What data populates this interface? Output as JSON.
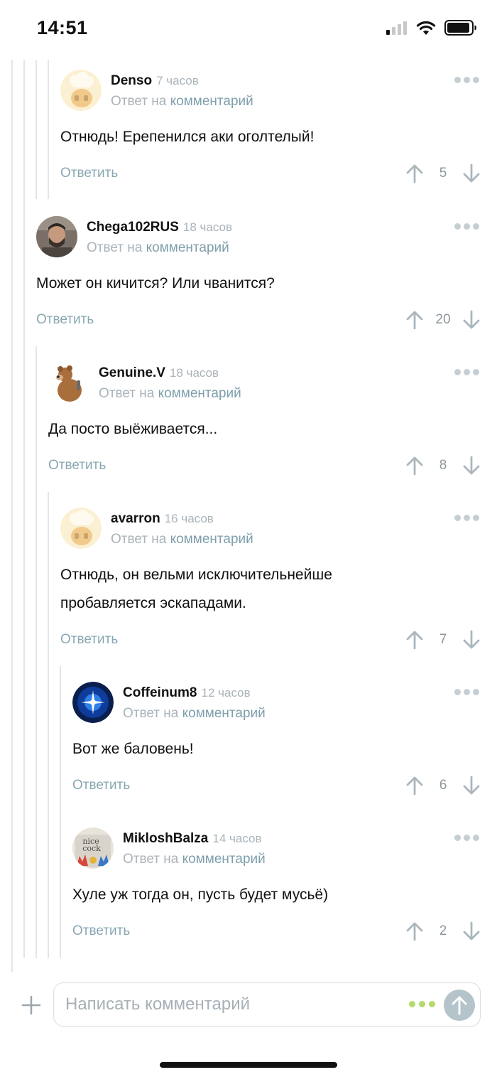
{
  "status_bar": {
    "time": "14:51"
  },
  "comments": [
    {
      "author": "Denso",
      "time": "7 часов",
      "reply_prefix": "Ответ на",
      "reply_link": "комментарий",
      "body": "Отнюдь! Ерепенился аки оголтелый!",
      "reply_label": "Ответить",
      "score": "5"
    },
    {
      "author": "Chega102RUS",
      "time": "18 часов",
      "reply_prefix": "Ответ на",
      "reply_link": "комментарий",
      "body": "Может он кичится? Или чванится?",
      "reply_label": "Ответить",
      "score": "20"
    },
    {
      "author": "Genuine.V",
      "time": "18 часов",
      "reply_prefix": "Ответ на",
      "reply_link": "комментарий",
      "body": "Да посто выёживается...",
      "reply_label": "Ответить",
      "score": "8"
    },
    {
      "author": "avarron",
      "time": "16 часов",
      "reply_prefix": "Ответ на",
      "reply_link": "комментарий",
      "body_lines": [
        "Отнюдь, он вельми исключительнейше",
        "пробавляется эскападами."
      ],
      "reply_label": "Ответить",
      "score": "7"
    },
    {
      "author": "Coffeinum8",
      "time": "12 часов",
      "reply_prefix": "Ответ на",
      "reply_link": "комментарий",
      "body": "Вот же баловень!",
      "reply_label": "Ответить",
      "score": "6"
    },
    {
      "author": "MikloshBalza",
      "time": "14 часов",
      "reply_prefix": "Ответ на",
      "reply_link": "комментарий",
      "body": "Хуле уж тогда он, пусть будет мусьё)",
      "reply_label": "Ответить",
      "score": "2"
    }
  ],
  "avatar_text": {
    "mikloshbalza": [
      "nice",
      "cock"
    ]
  },
  "composer": {
    "placeholder": "Написать комментарий"
  },
  "colors": {
    "accent_link": "#7e9fab",
    "muted": "#a9b3b9",
    "typing_dots": "#b6d96b",
    "send_button": "#b5c4cb"
  }
}
